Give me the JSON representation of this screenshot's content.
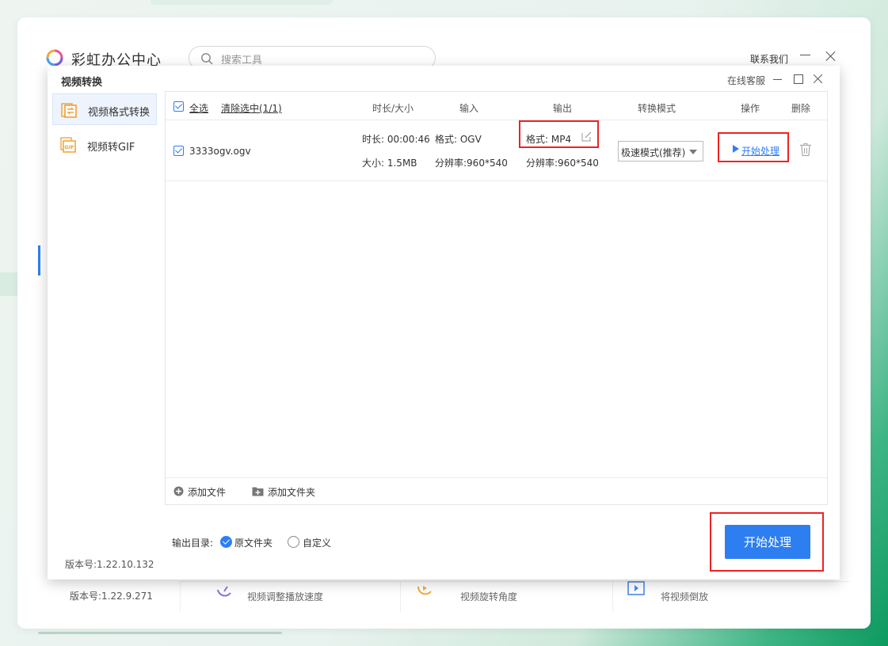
{
  "main_window": {
    "title": "彩虹办公中心",
    "search_placeholder": "搜索工具",
    "contact_label": "联系我们",
    "version": "版本号:1.22.9.271",
    "tool_cards": [
      {
        "label": "视频调整播放速度"
      },
      {
        "label": "视频旋转角度"
      },
      {
        "label": "将视频倒放"
      }
    ]
  },
  "dialog": {
    "title": "视频转换",
    "online_service": "在线客服",
    "sidebar": {
      "items": [
        {
          "label": "视频格式转换",
          "icon": "convert-icon",
          "active": true
        },
        {
          "label": "视频转GIF",
          "icon": "gif-icon",
          "active": false
        }
      ],
      "version": "版本号:1.22.10.132"
    },
    "table": {
      "select_all": "全选",
      "clear_selection": "清除选中(1/1)",
      "headers": {
        "duration_size": "时长/大小",
        "input": "输入",
        "output": "输出",
        "mode": "转换模式",
        "action": "操作",
        "delete": "删除"
      },
      "rows": [
        {
          "filename": "3333ogv.ogv",
          "duration": "时长: 00:00:46",
          "size": "大小: 1.5MB",
          "input_format": "格式: OGV",
          "input_resolution": "分辨率:960*540",
          "output_format": "格式: MP4",
          "output_resolution": "分辨率:960*540",
          "mode": "极速模式(推荐)",
          "action": "开始处理"
        }
      ]
    },
    "footer": {
      "add_file": "添加文件",
      "add_folder": "添加文件夹"
    },
    "output": {
      "label": "输出目录:",
      "options": [
        {
          "label": "原文件夹",
          "selected": true
        },
        {
          "label": "自定义",
          "selected": false
        }
      ]
    },
    "start_button": "开始处理"
  },
  "colors": {
    "accent": "#2d7ef0",
    "highlight": "#e22222"
  }
}
